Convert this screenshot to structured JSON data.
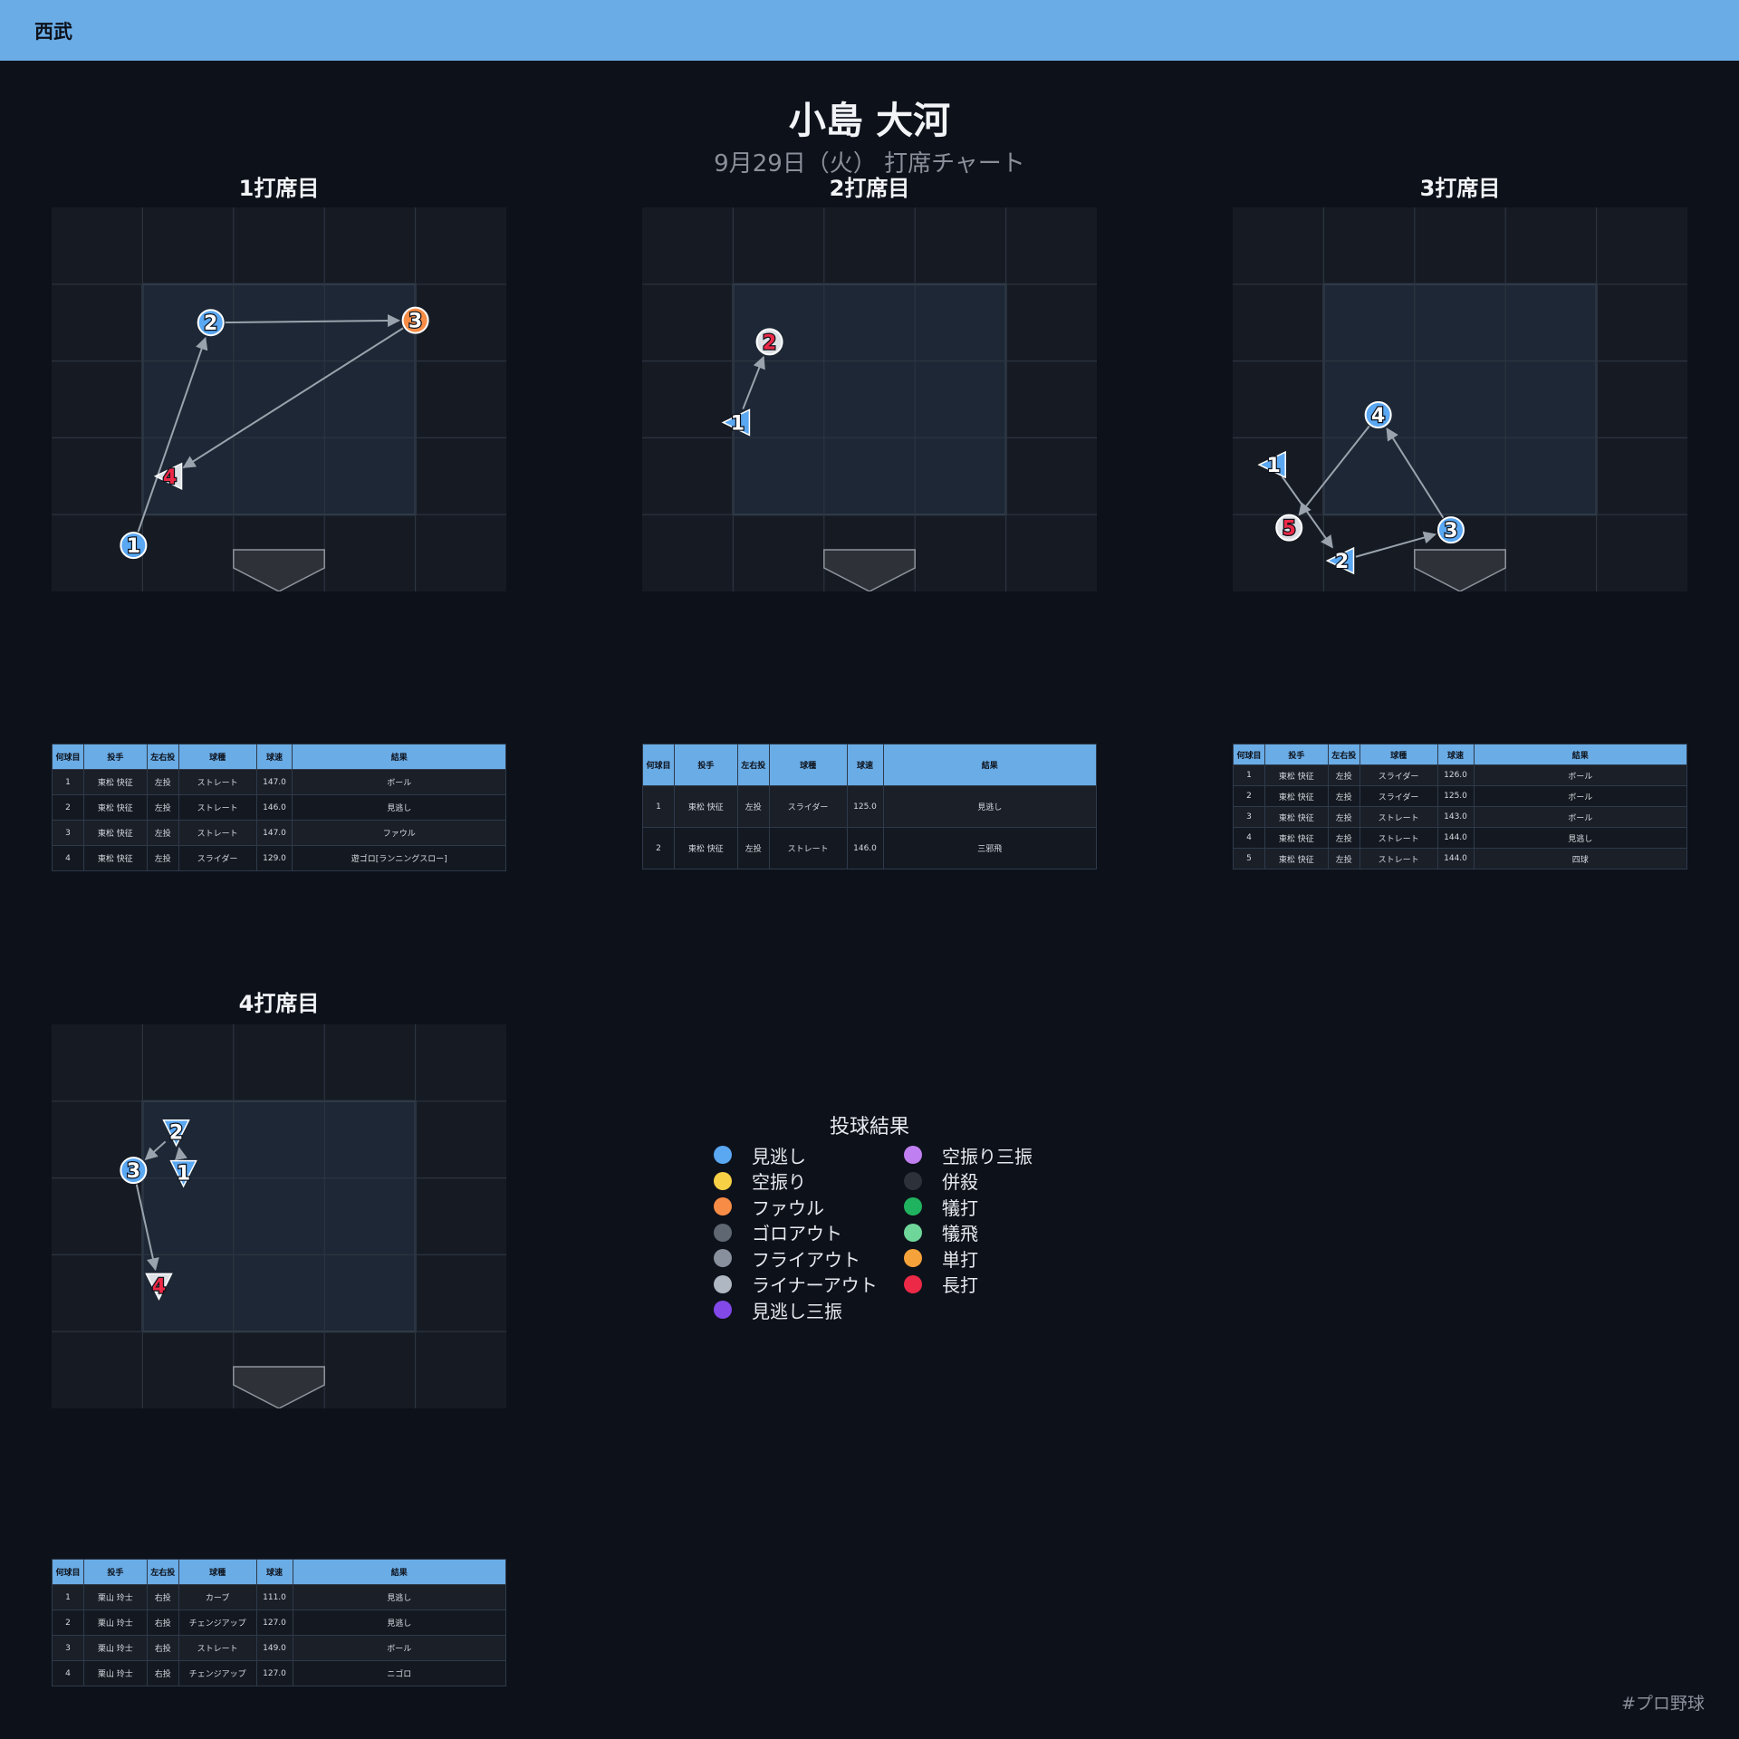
{
  "header": {
    "team": "西武"
  },
  "title": "小島 大河",
  "subtitle": "9月29日（火） 打席チャート",
  "table_headers": [
    "何球目",
    "投手",
    "左右投",
    "球種",
    "球速",
    "結果"
  ],
  "colors": {
    "見逃し": "#5aa7f2",
    "空振り": "#f7d046",
    "ファウル": "#f78c46",
    "ゴロアウト": "#5f6772",
    "フライアウト": "#87909c",
    "ライナーアウト": "#aeb7c2",
    "見逃し三振": "#8248e8",
    "空振り三振": "#c07ff0",
    "併殺": "#2c313a",
    "犠打": "#20b35f",
    "犠飛": "#6fd69a",
    "単打": "#f6a23a",
    "長打": "#ec2947"
  },
  "legend": {
    "title": "投球結果",
    "items": [
      {
        "label": "見逃し",
        "color": "#5aa7f2"
      },
      {
        "label": "空振り三振",
        "color": "#c07ff0"
      },
      {
        "label": "空振り",
        "color": "#f7d046"
      },
      {
        "label": "併殺",
        "color": "#2c313a"
      },
      {
        "label": "ファウル",
        "color": "#f78c46"
      },
      {
        "label": "犠打",
        "color": "#20b35f"
      },
      {
        "label": "ゴロアウト",
        "color": "#5f6772"
      },
      {
        "label": "犠飛",
        "color": "#6fd69a"
      },
      {
        "label": "フライアウト",
        "color": "#87909c"
      },
      {
        "label": "単打",
        "color": "#f6a23a"
      },
      {
        "label": "ライナーアウト",
        "color": "#aeb7c2"
      },
      {
        "label": "長打",
        "color": "#ec2947"
      },
      {
        "label": "見逃し三振",
        "color": "#8248e8"
      }
    ]
  },
  "chart_data": [
    {
      "type": "scatter",
      "title": "1打席目",
      "xlim": [
        0,
        5
      ],
      "ylim": [
        0,
        5
      ],
      "strike_zone": {
        "x": [
          1,
          4
        ],
        "y": [
          1,
          4
        ]
      },
      "pitches": [
        {
          "n": 1,
          "x": 0.9,
          "y": 0.6,
          "shape": "circle",
          "color": "#5aa7f2",
          "label_color": "#ffffff",
          "pitcher": "東松 快征",
          "hand": "左投",
          "pitch_type": "ストレート",
          "speed": "147.0",
          "result": "ボール"
        },
        {
          "n": 2,
          "x": 1.75,
          "y": 3.5,
          "shape": "circle",
          "color": "#5aa7f2",
          "label_color": "#ffffff",
          "pitcher": "東松 快征",
          "hand": "左投",
          "pitch_type": "ストレート",
          "speed": "146.0",
          "result": "見逃し"
        },
        {
          "n": 3,
          "x": 4.0,
          "y": 3.53,
          "shape": "circle",
          "color": "#f78c46",
          "label_color": "#ffffff",
          "pitcher": "東松 快征",
          "hand": "左投",
          "pitch_type": "ストレート",
          "speed": "147.0",
          "result": "ファウル"
        },
        {
          "n": 4,
          "x": 1.3,
          "y": 1.5,
          "shape": "tri-left",
          "color": "#dde1e6",
          "label_color": "#ec2947",
          "pitcher": "東松 快征",
          "hand": "左投",
          "pitch_type": "スライダー",
          "speed": "129.0",
          "result": "遊ゴロ[ランニングスロー]"
        }
      ]
    },
    {
      "type": "scatter",
      "title": "2打席目",
      "xlim": [
        0,
        5
      ],
      "ylim": [
        0,
        5
      ],
      "strike_zone": {
        "x": [
          1,
          4
        ],
        "y": [
          1,
          4
        ]
      },
      "pitches": [
        {
          "n": 1,
          "x": 1.05,
          "y": 2.2,
          "shape": "tri-left",
          "color": "#5aa7f2",
          "label_color": "#ffffff",
          "pitcher": "東松 快征",
          "hand": "左投",
          "pitch_type": "スライダー",
          "speed": "125.0",
          "result": "見逃し"
        },
        {
          "n": 2,
          "x": 1.4,
          "y": 3.25,
          "shape": "circle",
          "color": "#dde1e6",
          "label_color": "#ec2947",
          "pitcher": "東松 快征",
          "hand": "左投",
          "pitch_type": "ストレート",
          "speed": "146.0",
          "result": "三邪飛"
        }
      ]
    },
    {
      "type": "scatter",
      "title": "3打席目",
      "xlim": [
        0,
        5
      ],
      "ylim": [
        0,
        5
      ],
      "strike_zone": {
        "x": [
          1,
          4
        ],
        "y": [
          1,
          4
        ]
      },
      "pitches": [
        {
          "n": 1,
          "x": 0.45,
          "y": 1.65,
          "shape": "tri-left",
          "color": "#5aa7f2",
          "label_color": "#ffffff",
          "pitcher": "東松 快征",
          "hand": "左投",
          "pitch_type": "スライダー",
          "speed": "126.0",
          "result": "ボール"
        },
        {
          "n": 2,
          "x": 1.2,
          "y": 0.4,
          "shape": "tri-left",
          "color": "#5aa7f2",
          "label_color": "#ffffff",
          "pitcher": "東松 快征",
          "hand": "左投",
          "pitch_type": "スライダー",
          "speed": "125.0",
          "result": "ボール"
        },
        {
          "n": 3,
          "x": 2.4,
          "y": 0.8,
          "shape": "circle",
          "color": "#5aa7f2",
          "label_color": "#ffffff",
          "pitcher": "東松 快征",
          "hand": "左投",
          "pitch_type": "ストレート",
          "speed": "143.0",
          "result": "ボール"
        },
        {
          "n": 4,
          "x": 1.6,
          "y": 2.3,
          "shape": "circle",
          "color": "#5aa7f2",
          "label_color": "#ffffff",
          "pitcher": "東松 快征",
          "hand": "左投",
          "pitch_type": "ストレート",
          "speed": "144.0",
          "result": "見逃し"
        },
        {
          "n": 5,
          "x": 0.62,
          "y": 0.83,
          "shape": "circle",
          "color": "#dde1e6",
          "label_color": "#ec2947",
          "pitcher": "東松 快征",
          "hand": "左投",
          "pitch_type": "ストレート",
          "speed": "144.0",
          "result": "四球"
        }
      ]
    },
    {
      "type": "scatter",
      "title": "4打席目",
      "xlim": [
        0,
        5
      ],
      "ylim": [
        0,
        5
      ],
      "strike_zone": {
        "x": [
          1,
          4
        ],
        "y": [
          1,
          4
        ]
      },
      "pitches": [
        {
          "n": 1,
          "x": 1.45,
          "y": 3.07,
          "shape": "tri-down",
          "color": "#5aa7f2",
          "label_color": "#ffffff",
          "pitcher": "栗山 玲士",
          "hand": "右投",
          "pitch_type": "カーブ",
          "speed": "111.0",
          "result": "見逃し"
        },
        {
          "n": 2,
          "x": 1.37,
          "y": 3.6,
          "shape": "tri-down",
          "color": "#5aa7f2",
          "label_color": "#ffffff",
          "pitcher": "栗山 玲士",
          "hand": "右投",
          "pitch_type": "チェンジアップ",
          "speed": "127.0",
          "result": "見逃し"
        },
        {
          "n": 3,
          "x": 0.9,
          "y": 3.1,
          "shape": "circle",
          "color": "#5aa7f2",
          "label_color": "#ffffff",
          "pitcher": "栗山 玲士",
          "hand": "右投",
          "pitch_type": "ストレート",
          "speed": "149.0",
          "result": "ボール"
        },
        {
          "n": 4,
          "x": 1.18,
          "y": 1.6,
          "shape": "tri-down",
          "color": "#dde1e6",
          "label_color": "#ec2947",
          "pitcher": "栗山 玲士",
          "hand": "右投",
          "pitch_type": "チェンジアップ",
          "speed": "127.0",
          "result": "ニゴロ"
        }
      ]
    }
  ],
  "footer": {
    "hashtag": "#プロ野球"
  }
}
